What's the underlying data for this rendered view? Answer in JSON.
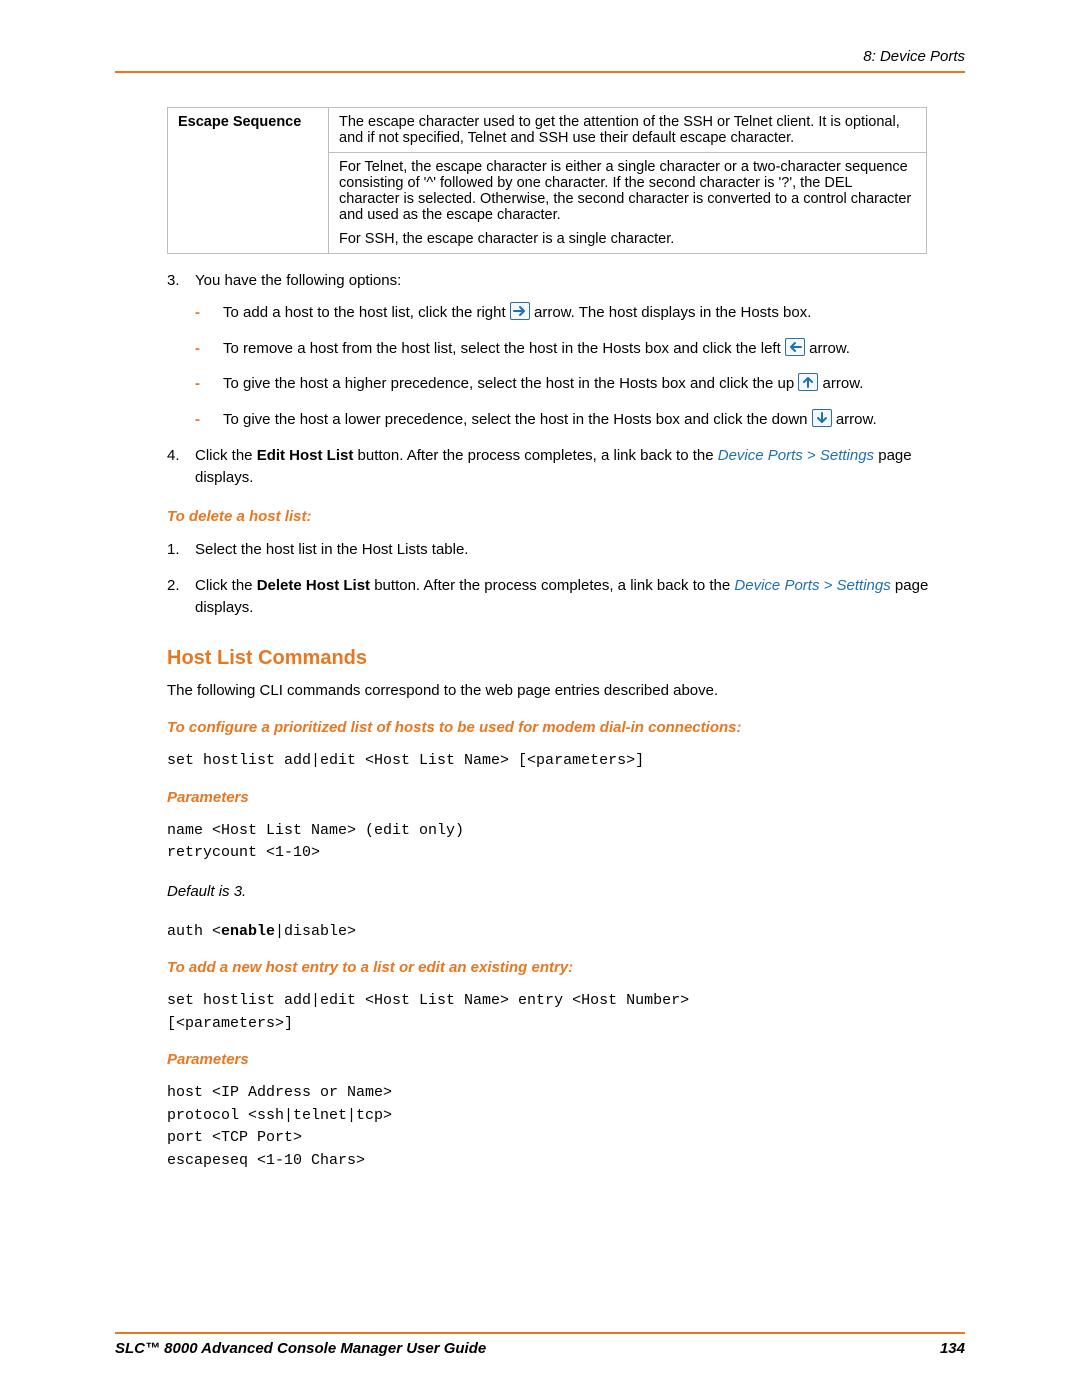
{
  "header": {
    "right": "8: Device Ports"
  },
  "table": {
    "label": "Escape Sequence",
    "p1": "The escape character used to get the attention of the SSH or Telnet client.  It is optional, and if not specified, Telnet and SSH use their default escape character.",
    "p2": "For Telnet, the escape character is either a single character or a two-character sequence consisting of  '^' followed by one character. If the second character is '?', the DEL character is selected. Otherwise, the second character is converted to a control character and used as the escape character.",
    "p3": "For SSH, the escape character is a single character."
  },
  "step3": {
    "intro": "You have the following options:",
    "b1a": "To add a host to the host list, click the right ",
    "b1b": " arrow. The host displays in the Hosts box.",
    "b2a": "To remove a host from the host list, select the host in the Hosts box and click the left ",
    "b2b": " arrow.",
    "b3a": "To give the host a higher precedence, select the host in the Hosts box and click the up ",
    "b3b": " arrow.",
    "b4a": "To give the host a lower precedence, select the host in the Hosts box and click the down ",
    "b4b": " arrow."
  },
  "step4": {
    "a": "Click the ",
    "btn": "Edit Host List",
    "b": " button. After the process completes, a link back to the ",
    "link": "Device Ports > Settings",
    "c": " page displays."
  },
  "delete": {
    "heading": "To delete a host list:",
    "s1": "Select the host list in the Host Lists table.",
    "s2a": "Click the ",
    "s2btn": "Delete Host List",
    "s2b": " button. After the process completes, a link back to the ",
    "s2link": "Device Ports > Settings",
    "s2c": " page displays."
  },
  "hlc": {
    "title": "Host List Commands",
    "intro": "The following CLI commands correspond to the web page entries described above.",
    "cfg_head": "To configure a prioritized list of hosts to be used for modem dial-in connections:",
    "cfg_code": "set hostlist add|edit <Host List Name> [<parameters>]",
    "params_head": "Parameters",
    "params_code": "name <Host List Name> (edit only)\nretrycount <1-10>",
    "default": "Default is 3.",
    "auth_pre": "auth <",
    "auth_bold": "enable",
    "auth_post": "|disable>",
    "add_head": "To add a new host entry to a list or edit an existing entry:",
    "add_code": "set hostlist add|edit <Host List Name> entry <Host Number>\n[<parameters>]",
    "params2_head": "Parameters",
    "params2_code": "host <IP Address or Name>\nprotocol <ssh|telnet|tcp>\nport <TCP Port>\nescapeseq <1-10 Chars>"
  },
  "footer": {
    "left": "SLC™ 8000 Advanced Console Manager User Guide",
    "right": "134"
  }
}
